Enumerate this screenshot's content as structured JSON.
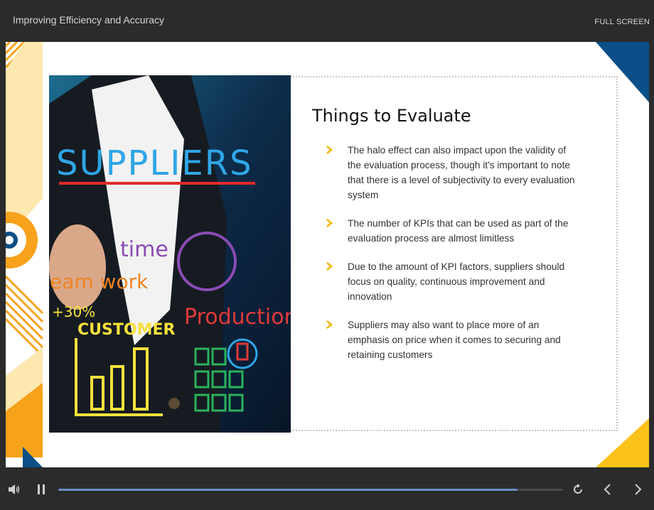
{
  "header": {
    "course_title": "Improving Efficiency and Accuracy",
    "fullscreen_label": "FULL SCREEN"
  },
  "slide": {
    "heading": "Things to Evaluate",
    "image": {
      "main_word": "SUPPLIERS",
      "words": [
        "time",
        "team work",
        "+30%",
        "CUSTOMER",
        "Production"
      ]
    },
    "bullets": [
      "The halo effect can also impact upon the validity of the evaluation process, though it's important to note that there is a level of subjectivity to every evaluation system",
      "The number of KPIs that can be used as part of the evaluation process are almost limitless",
      "Due to the amount of KPI factors, suppliers should focus on quality, continuous improvement and innovation",
      "Suppliers may also want to place more of an emphasis on price when it comes to securing and retaining customers"
    ],
    "colors": {
      "accent_orange": "#f7a21b",
      "accent_yellow": "#fbc21a",
      "accent_blue": "#0a4f87",
      "chevron": "#f5b700"
    }
  },
  "player": {
    "progress": 0.91,
    "icons": {
      "volume": "volume-icon",
      "pause": "pause-icon",
      "replay": "replay-icon",
      "previous": "chevron-left-icon",
      "next": "chevron-right-icon"
    }
  }
}
